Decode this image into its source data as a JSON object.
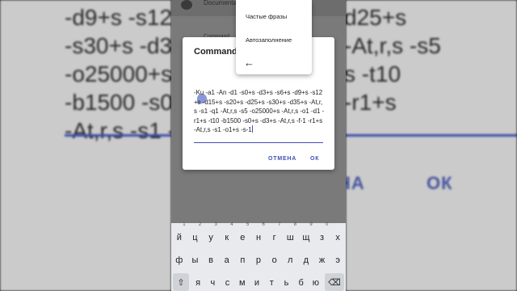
{
  "background": {
    "left_text": "-d9+s -s12+\n-s30+s -d3\n-o25000+s\n-b1500 -s0\n-At,r,s -s1 -",
    "right_text": "d25+s\n-At,r,s -s5\ns -t10\n-r1+s\n",
    "right_cancel": "НА",
    "right_ok": "ОК"
  },
  "appbar": {
    "documents_label": "Documenta"
  },
  "hint": "Command",
  "dialog": {
    "title": "Command l",
    "command_text": "-Ku -a1 -An -d1 -s0+s -d3+s -s6+s -d9+s -s12+s -d15+s -s20+s -d25+s -s30+s -d35+s -At,r,s -s1 -q1 -At,r,s -s5 -o25000+s -At,r,s -o1 -d1 -r1+s -t10 -b1500 -s0+s -d3+s -At,r,s -f-1 -r1+s -At,r,s -s1 -o1+s -s-1",
    "cancel_label": "ОТМЕНА",
    "ok_label": "ОК"
  },
  "popup": {
    "item1": "Частые фразы",
    "item2": "Автозаполнение",
    "back_icon": "←"
  },
  "keyboard": {
    "row1": [
      {
        "k": "й",
        "n": "1"
      },
      {
        "k": "ц",
        "n": "2"
      },
      {
        "k": "у",
        "n": "3"
      },
      {
        "k": "к",
        "n": "4"
      },
      {
        "k": "е",
        "n": "5"
      },
      {
        "k": "н",
        "n": "6"
      },
      {
        "k": "г",
        "n": "7"
      },
      {
        "k": "ш",
        "n": "8"
      },
      {
        "k": "щ",
        "n": "9"
      },
      {
        "k": "з",
        "n": "0"
      },
      {
        "k": "х",
        "n": ""
      }
    ],
    "row2": [
      "ф",
      "ы",
      "в",
      "а",
      "п",
      "р",
      "о",
      "л",
      "д",
      "ж",
      "э"
    ],
    "row3": [
      "я",
      "ч",
      "с",
      "м",
      "и",
      "т",
      "ь",
      "б",
      "ю"
    ],
    "shift_icon": "⇧",
    "backspace_icon": "⌫"
  }
}
